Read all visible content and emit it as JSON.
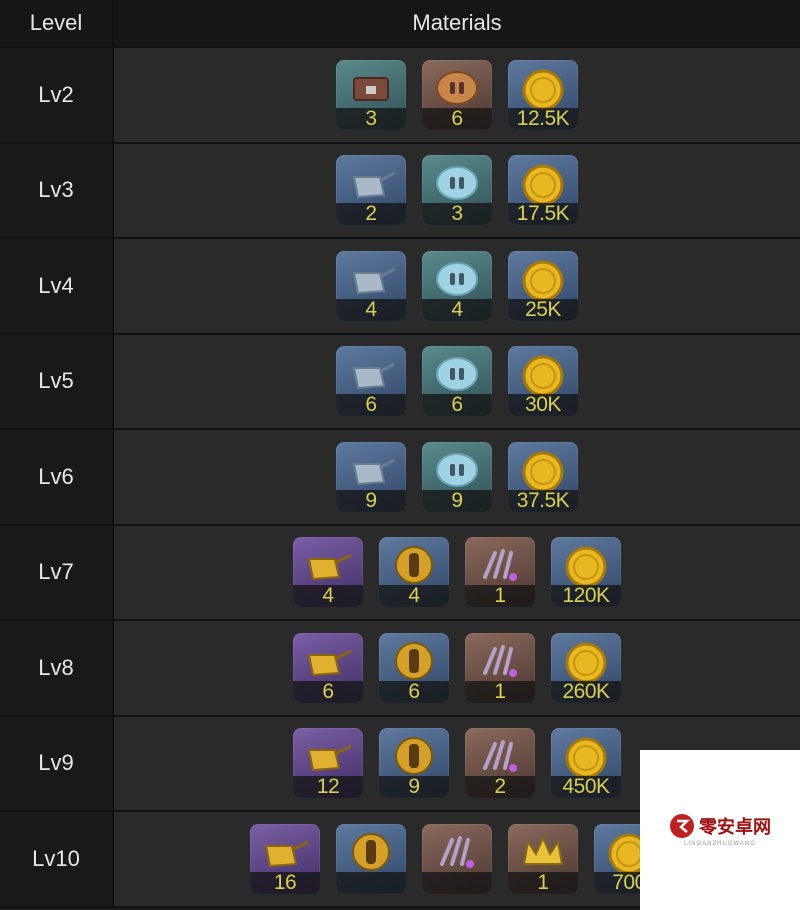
{
  "header": {
    "level_label": "Level",
    "materials_label": "Materials"
  },
  "rows": [
    {
      "level": "Lv2",
      "items": [
        {
          "icon": "chest-icon",
          "bg": "c-teal",
          "qty": "3"
        },
        {
          "icon": "shell-icon",
          "bg": "c-brown",
          "qty": "6"
        },
        {
          "icon": "gold-coin-icon",
          "bg": "c-blue",
          "qty": "12.5K"
        }
      ]
    },
    {
      "level": "Lv3",
      "items": [
        {
          "icon": "watering-can-icon",
          "bg": "c-blue",
          "qty": "2"
        },
        {
          "icon": "crystal-shell-icon",
          "bg": "c-teal",
          "qty": "3"
        },
        {
          "icon": "gold-coin-icon",
          "bg": "c-blue",
          "qty": "17.5K"
        }
      ]
    },
    {
      "level": "Lv4",
      "items": [
        {
          "icon": "watering-can-icon",
          "bg": "c-blue",
          "qty": "4"
        },
        {
          "icon": "crystal-shell-icon",
          "bg": "c-teal",
          "qty": "4"
        },
        {
          "icon": "gold-coin-icon",
          "bg": "c-blue",
          "qty": "25K"
        }
      ]
    },
    {
      "level": "Lv5",
      "items": [
        {
          "icon": "watering-can-icon",
          "bg": "c-blue",
          "qty": "6"
        },
        {
          "icon": "crystal-shell-icon",
          "bg": "c-teal",
          "qty": "6"
        },
        {
          "icon": "gold-coin-icon",
          "bg": "c-blue",
          "qty": "30K"
        }
      ]
    },
    {
      "level": "Lv6",
      "items": [
        {
          "icon": "watering-can-icon",
          "bg": "c-blue",
          "qty": "9"
        },
        {
          "icon": "crystal-shell-icon",
          "bg": "c-teal",
          "qty": "9"
        },
        {
          "icon": "gold-coin-icon",
          "bg": "c-blue",
          "qty": "37.5K"
        }
      ]
    },
    {
      "level": "Lv7",
      "items": [
        {
          "icon": "golden-can-icon",
          "bg": "c-purple",
          "qty": "4"
        },
        {
          "icon": "golden-shell-icon",
          "bg": "c-blue",
          "qty": "4"
        },
        {
          "icon": "claw-icon",
          "bg": "c-brown",
          "qty": "1"
        },
        {
          "icon": "gold-coin-icon",
          "bg": "c-blue",
          "qty": "120K"
        }
      ]
    },
    {
      "level": "Lv8",
      "items": [
        {
          "icon": "golden-can-icon",
          "bg": "c-purple",
          "qty": "6"
        },
        {
          "icon": "golden-shell-icon",
          "bg": "c-blue",
          "qty": "6"
        },
        {
          "icon": "claw-icon",
          "bg": "c-brown",
          "qty": "1"
        },
        {
          "icon": "gold-coin-icon",
          "bg": "c-blue",
          "qty": "260K"
        }
      ]
    },
    {
      "level": "Lv9",
      "items": [
        {
          "icon": "golden-can-icon",
          "bg": "c-purple",
          "qty": "12"
        },
        {
          "icon": "golden-shell-icon",
          "bg": "c-blue",
          "qty": "9"
        },
        {
          "icon": "claw-icon",
          "bg": "c-brown",
          "qty": "2"
        },
        {
          "icon": "gold-coin-icon",
          "bg": "c-blue",
          "qty": "450K"
        }
      ]
    },
    {
      "level": "Lv10",
      "items": [
        {
          "icon": "golden-can-icon",
          "bg": "c-purple",
          "qty": "16"
        },
        {
          "icon": "golden-shell-icon",
          "bg": "c-blue",
          "qty": ""
        },
        {
          "icon": "claw-icon",
          "bg": "c-brown",
          "qty": ""
        },
        {
          "icon": "crown-icon",
          "bg": "c-brown",
          "qty": "1"
        },
        {
          "icon": "gold-coin-icon",
          "bg": "c-blue",
          "qty": "700"
        }
      ]
    }
  ],
  "watermark": {
    "text": "零安卓网",
    "sub": "LINGANZHUOWANG"
  }
}
